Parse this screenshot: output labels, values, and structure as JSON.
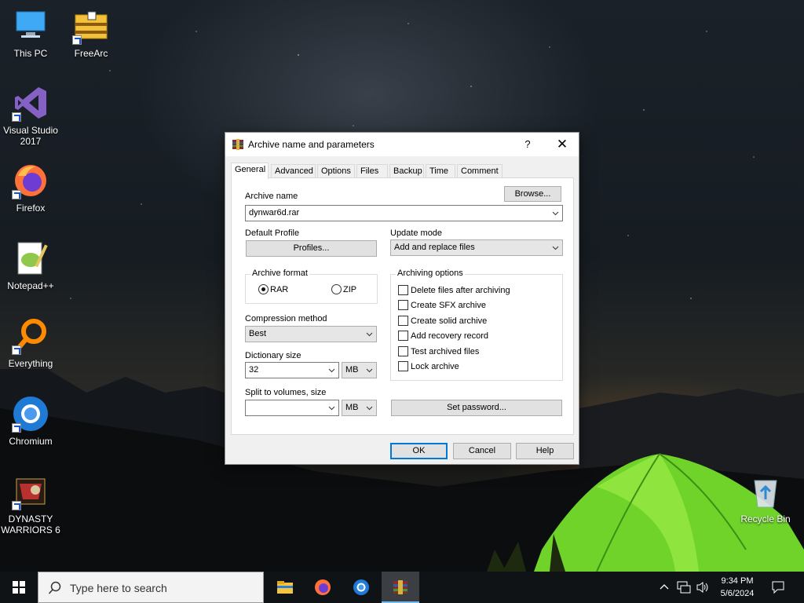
{
  "desktop": {
    "icons": [
      {
        "label_line1": "This PC",
        "label_line2": ""
      },
      {
        "label_line1": "FreeArc",
        "label_line2": ""
      },
      {
        "label_line1": "Visual Studio",
        "label_line2": "2017"
      },
      {
        "label_line1": "Firefox",
        "label_line2": ""
      },
      {
        "label_line1": "Notepad++",
        "label_line2": ""
      },
      {
        "label_line1": "Everything",
        "label_line2": ""
      },
      {
        "label_line1": "Chromium",
        "label_line2": ""
      },
      {
        "label_line1": "DYNASTY",
        "label_line2": "WARRIORS 6"
      },
      {
        "label_line1": "Recycle Bin",
        "label_line2": ""
      }
    ]
  },
  "dialog": {
    "title": "Archive name and parameters",
    "help_glyph": "?",
    "close_glyph": "✕",
    "tabs": [
      "General",
      "Advanced",
      "Options",
      "Files",
      "Backup",
      "Time",
      "Comment"
    ],
    "active_tab": "General",
    "archive_name_label": "Archive name",
    "browse_label": "Browse...",
    "archive_name_value": "dynwar6d.rar",
    "default_profile_label": "Default Profile",
    "profiles_label": "Profiles...",
    "update_mode_label": "Update mode",
    "update_mode_value": "Add and replace files",
    "archive_format_label": "Archive format",
    "format_rar": "RAR",
    "format_zip": "ZIP",
    "selected_format": "RAR",
    "compression_method_label": "Compression method",
    "compression_method_value": "Best",
    "dictionary_size_label": "Dictionary size",
    "dictionary_size_value": "32",
    "dictionary_unit": "MB",
    "split_label": "Split to volumes, size",
    "split_value": "",
    "split_unit": "MB",
    "archiving_options_label": "Archiving options",
    "options": [
      {
        "label": "Delete files after archiving",
        "checked": false
      },
      {
        "label": "Create SFX archive",
        "checked": false
      },
      {
        "label": "Create solid archive",
        "checked": false
      },
      {
        "label": "Add recovery record",
        "checked": false
      },
      {
        "label": "Test archived files",
        "checked": false
      },
      {
        "label": "Lock archive",
        "checked": false
      }
    ],
    "set_password_label": "Set password...",
    "ok_label": "OK",
    "cancel_label": "Cancel",
    "help_label": "Help"
  },
  "taskbar": {
    "search_placeholder": "Type here to search",
    "time": "9:34 PM",
    "date": "5/6/2024"
  },
  "colors": {
    "accent": "#0078d7",
    "taskbar": "#101316",
    "dialog_bg": "#f0f0f0"
  }
}
